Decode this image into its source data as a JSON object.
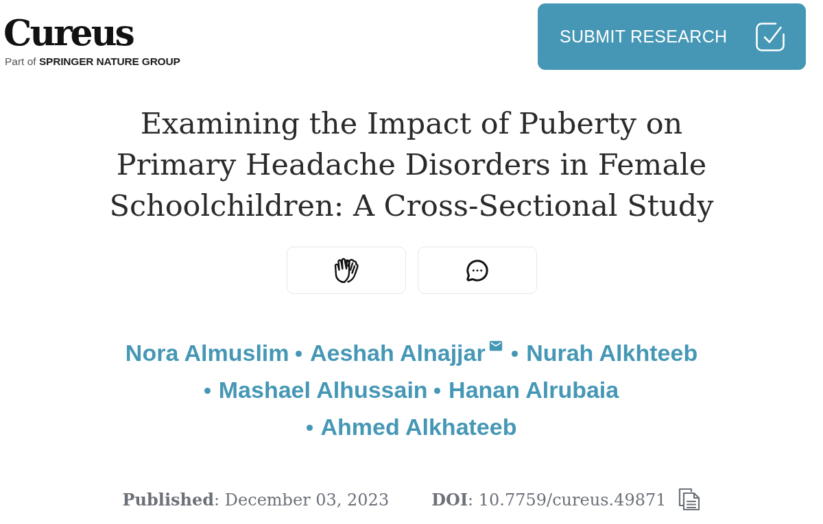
{
  "logo": {
    "name": "Cureus",
    "tagline": "Part of **SPRINGER NATURE GROUP**"
  },
  "submit_button": {
    "label": "SUBMIT RESEARCH"
  },
  "article": {
    "title": "Examining the Impact of Puberty on Primary Headache Disorders in Female Schoolchildren: A Cross-Sectional Study",
    "action_buttons": [
      {
        "kind": "applaud"
      },
      {
        "kind": "comment"
      }
    ],
    "authors": [
      {
        "name": "Nora Almuslim",
        "corresponding": false
      },
      {
        "name": "Aeshah Alnajjar",
        "corresponding": true
      },
      {
        "name": "Nurah Alkhteeb",
        "corresponding": false
      },
      {
        "name": "Mashael Alhussain",
        "corresponding": false
      },
      {
        "name": "Hanan Alrubaia",
        "corresponding": false
      },
      {
        "name": "Ahmed Alkhateeb",
        "corresponding": false
      }
    ],
    "published": "**Published**: December 03, 2023",
    "doi": "**DOI**: 10.7759/cureus.49871"
  }
}
